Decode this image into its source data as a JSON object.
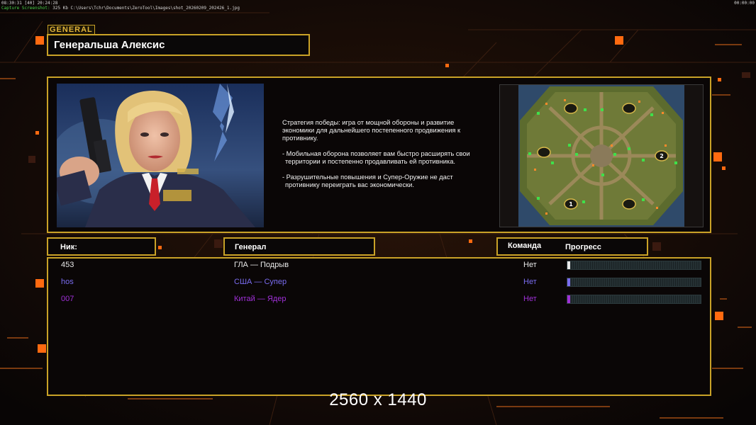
{
  "overlay": {
    "fps_line": "08:30:31 [40] 20:24:28",
    "capture_label": "Capture Screenshot:",
    "capture_info": "325 Kb C:\\Users\\Tchr\\Documents\\ZeroTool\\Images\\shot_20260209_202426_1.jpg",
    "clock": "00:00:00"
  },
  "general": {
    "tag": "GENERAL",
    "name": "Генеральша Алексис"
  },
  "description": {
    "para1": "Стратегия победы: игра от мощной обороны и развитие экономики для дальнейшего постепенного продвижения к противнику.",
    "para2": "- Мобильная оборона позволяет вам быстро расширять свои территории и постепенно продавливать ей противника.",
    "para3": "- Разрушительные повышения и Супер-Оружие не даст противнику переиграть вас экономически."
  },
  "minimap": {
    "start_positions": [
      "1",
      "2"
    ]
  },
  "headers": {
    "nick": "Ник:",
    "general": "Генерал",
    "team": "Команда",
    "progress": "Прогресс"
  },
  "players": [
    {
      "nick": "453",
      "general": "ГЛА — Подрыв",
      "team": "Нет",
      "color": "#e8e8e8",
      "progress": 0.02
    },
    {
      "nick": "hos",
      "general": "США — Супер",
      "team": "Нет",
      "color": "#7a6cf0",
      "progress": 0.02
    },
    {
      "nick": "007",
      "general": "Китай — Ядер",
      "team": "Нет",
      "color": "#a030d8",
      "progress": 0.02
    }
  ],
  "resolution_label": "2560 x 1440",
  "colors": {
    "frame": "#c9a227",
    "accent_orange": "#ff6a10",
    "bg": "#0b0707"
  }
}
